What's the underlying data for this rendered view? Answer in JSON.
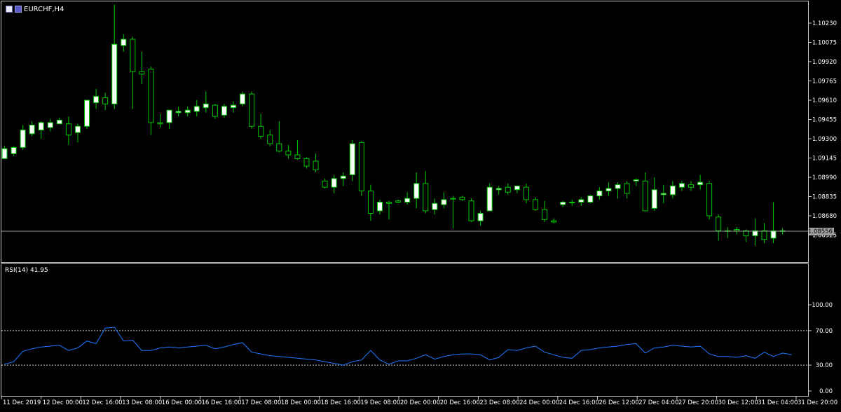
{
  "main_chart": {
    "symbol_title": "EURCHF,H4",
    "current_price_label": "1.08556",
    "current_price": 1.08556,
    "price_axis_labels": [
      "1.10230",
      "1.10075",
      "1.09920",
      "1.09765",
      "1.09610",
      "1.09455",
      "1.09300",
      "1.09145",
      "1.08990",
      "1.08835",
      "1.08680",
      "1.08525"
    ],
    "candle_colors": {
      "bull": "#ffffff",
      "bear": "#000000",
      "wick": "#00c800"
    }
  },
  "rsi_panel": {
    "label": "RSI(14) 41.95",
    "axis_labels": [
      "100.00",
      "70.00",
      "30.00",
      "0.00"
    ],
    "levels": [
      70,
      30
    ],
    "line_color": "#1e78ff"
  },
  "time_axis_labels": [
    "11 Dec 2019",
    "12 Dec 00:00",
    "12 Dec 16:00",
    "13 Dec 08:00",
    "16 Dec 00:00",
    "16 Dec 16:00",
    "17 Dec 08:00",
    "18 Dec 00:00",
    "18 Dec 16:00",
    "19 Dec 08:00",
    "20 Dec 00:00",
    "20 Dec 16:00",
    "23 Dec 08:00",
    "24 Dec 00:00",
    "24 Dec 16:00",
    "26 Dec 12:00",
    "27 Dec 04:00",
    "27 Dec 20:00",
    "30 Dec 12:00",
    "31 Dec 04:00",
    "31 Dec 20:00"
  ],
  "chart_data": {
    "type": "candlestick",
    "candles": [
      {
        "o": 1.0914,
        "h": 1.0924,
        "l": 1.0914,
        "c": 1.0922
      },
      {
        "o": 1.0918,
        "h": 1.0924,
        "l": 1.0916,
        "c": 1.0923
      },
      {
        "o": 1.0923,
        "h": 1.0941,
        "l": 1.0921,
        "c": 1.0937
      },
      {
        "o": 1.0934,
        "h": 1.0944,
        "l": 1.0932,
        "c": 1.0941
      },
      {
        "o": 1.0937,
        "h": 1.0944,
        "l": 1.093,
        "c": 1.0943
      },
      {
        "o": 1.0939,
        "h": 1.0946,
        "l": 1.0936,
        "c": 1.0943
      },
      {
        "o": 1.0942,
        "h": 1.0947,
        "l": 1.0942,
        "c": 1.0945
      },
      {
        "o": 1.0942,
        "h": 1.0948,
        "l": 1.0925,
        "c": 1.0933
      },
      {
        "o": 1.0935,
        "h": 1.0942,
        "l": 1.0927,
        "c": 1.094
      },
      {
        "o": 1.094,
        "h": 1.0952,
        "l": 1.0938,
        "c": 1.0961
      },
      {
        "o": 1.0959,
        "h": 1.097,
        "l": 1.0954,
        "c": 1.0964
      },
      {
        "o": 1.0963,
        "h": 1.0967,
        "l": 1.0953,
        "c": 1.0958
      },
      {
        "o": 1.0958,
        "h": 1.1038,
        "l": 1.0954,
        "c": 1.1006
      },
      {
        "o": 1.1005,
        "h": 1.1014,
        "l": 1.1,
        "c": 1.101
      },
      {
        "o": 1.101,
        "h": 1.1012,
        "l": 1.0954,
        "c": 1.0984
      },
      {
        "o": 1.0984,
        "h": 1.1,
        "l": 1.0974,
        "c": 1.0982
      },
      {
        "o": 1.0986,
        "h": 1.0988,
        "l": 1.0933,
        "c": 1.0943
      },
      {
        "o": 1.0943,
        "h": 1.095,
        "l": 1.0939,
        "c": 1.0942
      },
      {
        "o": 1.0943,
        "h": 1.0953,
        "l": 1.0938,
        "c": 1.0953
      },
      {
        "o": 1.0951,
        "h": 1.0956,
        "l": 1.0948,
        "c": 1.0952
      },
      {
        "o": 1.0951,
        "h": 1.0956,
        "l": 1.0948,
        "c": 1.0953
      },
      {
        "o": 1.0952,
        "h": 1.0961,
        "l": 1.0948,
        "c": 1.0956
      },
      {
        "o": 1.0955,
        "h": 1.0968,
        "l": 1.0951,
        "c": 1.0958
      },
      {
        "o": 1.0957,
        "h": 1.0958,
        "l": 1.0946,
        "c": 1.0948
      },
      {
        "o": 1.0949,
        "h": 1.0958,
        "l": 1.0947,
        "c": 1.0956
      },
      {
        "o": 1.0955,
        "h": 1.096,
        "l": 1.0951,
        "c": 1.0957
      },
      {
        "o": 1.0958,
        "h": 1.0968,
        "l": 1.0956,
        "c": 1.0966
      },
      {
        "o": 1.0966,
        "h": 1.0968,
        "l": 1.0938,
        "c": 1.094
      },
      {
        "o": 1.094,
        "h": 1.095,
        "l": 1.093,
        "c": 1.0932
      },
      {
        "o": 1.0933,
        "h": 1.0937,
        "l": 1.0924,
        "c": 1.0926
      },
      {
        "o": 1.0926,
        "h": 1.0944,
        "l": 1.0919,
        "c": 1.092
      },
      {
        "o": 1.092,
        "h": 1.0925,
        "l": 1.0914,
        "c": 1.0917
      },
      {
        "o": 1.0917,
        "h": 1.0929,
        "l": 1.0913,
        "c": 1.0914
      },
      {
        "o": 1.0914,
        "h": 1.0915,
        "l": 1.0906,
        "c": 1.0908
      },
      {
        "o": 1.0912,
        "h": 1.0918,
        "l": 1.0903,
        "c": 1.0905
      },
      {
        "o": 1.0896,
        "h": 1.0898,
        "l": 1.089,
        "c": 1.0891
      },
      {
        "o": 1.0891,
        "h": 1.0901,
        "l": 1.0886,
        "c": 1.0898
      },
      {
        "o": 1.0898,
        "h": 1.0903,
        "l": 1.0892,
        "c": 1.09
      },
      {
        "o": 1.0901,
        "h": 1.0929,
        "l": 1.0896,
        "c": 1.0926
      },
      {
        "o": 1.0927,
        "h": 1.0928,
        "l": 1.0884,
        "c": 1.0888
      },
      {
        "o": 1.0888,
        "h": 1.0893,
        "l": 1.0864,
        "c": 1.087
      },
      {
        "o": 1.0872,
        "h": 1.0881,
        "l": 1.0869,
        "c": 1.0879
      },
      {
        "o": 1.0879,
        "h": 1.088,
        "l": 1.0865,
        "c": 1.0878
      },
      {
        "o": 1.088,
        "h": 1.0881,
        "l": 1.0878,
        "c": 1.0879
      },
      {
        "o": 1.0879,
        "h": 1.0887,
        "l": 1.0877,
        "c": 1.0882
      },
      {
        "o": 1.0882,
        "h": 1.0903,
        "l": 1.0874,
        "c": 1.0894
      },
      {
        "o": 1.0894,
        "h": 1.0904,
        "l": 1.087,
        "c": 1.0872
      },
      {
        "o": 1.0873,
        "h": 1.0882,
        "l": 1.0869,
        "c": 1.0878
      },
      {
        "o": 1.0877,
        "h": 1.0887,
        "l": 1.0874,
        "c": 1.0881
      },
      {
        "o": 1.0882,
        "h": 1.0884,
        "l": 1.0858,
        "c": 1.0882
      },
      {
        "o": 1.0883,
        "h": 1.0884,
        "l": 1.088,
        "c": 1.0881
      },
      {
        "o": 1.088,
        "h": 1.0882,
        "l": 1.0863,
        "c": 1.0864
      },
      {
        "o": 1.0864,
        "h": 1.0872,
        "l": 1.086,
        "c": 1.087
      },
      {
        "o": 1.0872,
        "h": 1.0894,
        "l": 1.0872,
        "c": 1.0891
      },
      {
        "o": 1.0889,
        "h": 1.0892,
        "l": 1.0885,
        "c": 1.089
      },
      {
        "o": 1.0891,
        "h": 1.0894,
        "l": 1.0885,
        "c": 1.0887
      },
      {
        "o": 1.0889,
        "h": 1.0892,
        "l": 1.0886,
        "c": 1.0892
      },
      {
        "o": 1.0891,
        "h": 1.0894,
        "l": 1.0878,
        "c": 1.0881
      },
      {
        "o": 1.0881,
        "h": 1.0883,
        "l": 1.0872,
        "c": 1.0873
      },
      {
        "o": 1.0873,
        "h": 1.088,
        "l": 1.0863,
        "c": 1.0865
      },
      {
        "o": 1.0864,
        "h": 1.0866,
        "l": 1.0862,
        "c": 1.0863
      },
      {
        "o": 1.0877,
        "h": 1.088,
        "l": 1.0875,
        "c": 1.0879
      },
      {
        "o": 1.0879,
        "h": 1.0881,
        "l": 1.0876,
        "c": 1.0879
      },
      {
        "o": 1.0879,
        "h": 1.0883,
        "l": 1.0876,
        "c": 1.0881
      },
      {
        "o": 1.0879,
        "h": 1.0885,
        "l": 1.0878,
        "c": 1.0884
      },
      {
        "o": 1.0884,
        "h": 1.0891,
        "l": 1.0881,
        "c": 1.0888
      },
      {
        "o": 1.0888,
        "h": 1.0895,
        "l": 1.0884,
        "c": 1.089
      },
      {
        "o": 1.089,
        "h": 1.0895,
        "l": 1.0882,
        "c": 1.0893
      },
      {
        "o": 1.0894,
        "h": 1.0896,
        "l": 1.0882,
        "c": 1.0886
      },
      {
        "o": 1.0896,
        "h": 1.0898,
        "l": 1.0892,
        "c": 1.0897
      },
      {
        "o": 1.0896,
        "h": 1.0903,
        "l": 1.0872,
        "c": 1.0872
      },
      {
        "o": 1.0874,
        "h": 1.0899,
        "l": 1.0872,
        "c": 1.0889
      },
      {
        "o": 1.0885,
        "h": 1.0893,
        "l": 1.0878,
        "c": 1.0886
      },
      {
        "o": 1.0885,
        "h": 1.0896,
        "l": 1.0882,
        "c": 1.0892
      },
      {
        "o": 1.0891,
        "h": 1.0896,
        "l": 1.0888,
        "c": 1.0894
      },
      {
        "o": 1.0893,
        "h": 1.0896,
        "l": 1.0888,
        "c": 1.0891
      },
      {
        "o": 1.0893,
        "h": 1.0901,
        "l": 1.0889,
        "c": 1.0895
      },
      {
        "o": 1.0894,
        "h": 1.0896,
        "l": 1.0865,
        "c": 1.0868
      },
      {
        "o": 1.0867,
        "h": 1.0869,
        "l": 1.0848,
        "c": 1.0856
      },
      {
        "o": 1.0856,
        "h": 1.0859,
        "l": 1.085,
        "c": 1.0856
      },
      {
        "o": 1.0857,
        "h": 1.0859,
        "l": 1.0853,
        "c": 1.0856
      },
      {
        "o": 1.0856,
        "h": 1.0857,
        "l": 1.0847,
        "c": 1.0852
      },
      {
        "o": 1.0852,
        "h": 1.0866,
        "l": 1.0844,
        "c": 1.0856
      },
      {
        "o": 1.0856,
        "h": 1.0862,
        "l": 1.0846,
        "c": 1.0849
      },
      {
        "o": 1.085,
        "h": 1.0879,
        "l": 1.0846,
        "c": 1.0856
      },
      {
        "o": 1.0856,
        "h": 1.0858,
        "l": 1.0853,
        "c": 1.08556
      }
    ],
    "rsi_values": [
      31,
      34,
      46,
      49,
      51,
      52,
      53,
      47,
      50,
      58,
      55,
      73,
      74,
      58,
      59,
      47,
      47,
      50,
      51,
      50,
      51,
      52,
      53,
      49,
      51,
      54,
      56,
      45,
      43,
      41,
      40,
      39,
      38,
      37,
      36,
      34,
      32,
      30,
      34,
      36,
      47,
      36,
      31,
      35,
      35,
      38,
      42,
      37,
      40,
      42,
      43,
      43,
      42,
      36,
      39,
      48,
      47,
      50,
      52,
      45,
      42,
      39,
      38,
      47,
      48,
      50,
      51,
      52,
      54,
      55,
      44,
      50,
      51,
      53,
      52,
      51,
      52,
      43,
      40,
      40,
      39,
      41,
      38,
      45,
      40,
      44,
      42
    ]
  }
}
